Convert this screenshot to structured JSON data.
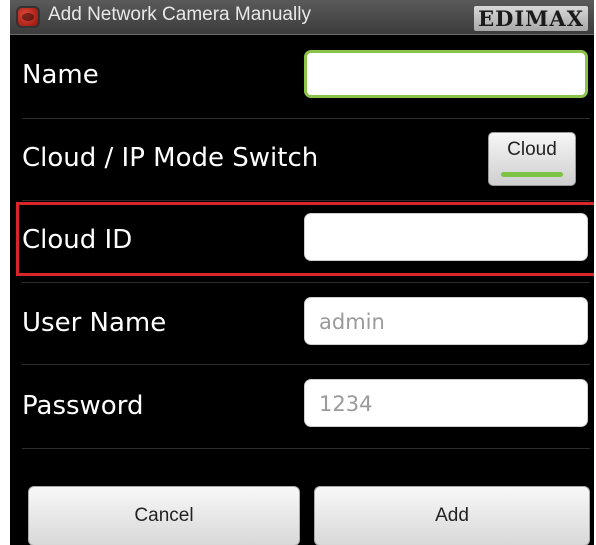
{
  "titlebar": {
    "title": "Add Network Camera Manually",
    "logo": "EDIMAX"
  },
  "form": {
    "name": {
      "label": "Name",
      "value": ""
    },
    "mode_switch": {
      "label": "Cloud / IP Mode Switch",
      "toggle_label": "Cloud",
      "toggle_on": true
    },
    "cloud_id": {
      "label": "Cloud ID",
      "value": ""
    },
    "user_name": {
      "label": "User Name",
      "placeholder": "admin"
    },
    "password": {
      "label": "Password",
      "placeholder": "1234"
    }
  },
  "buttons": {
    "cancel": "Cancel",
    "add": "Add"
  },
  "colors": {
    "highlight": "#d9262a",
    "toggle_on": "#7dc243",
    "focus_border": "#8bc34a"
  }
}
